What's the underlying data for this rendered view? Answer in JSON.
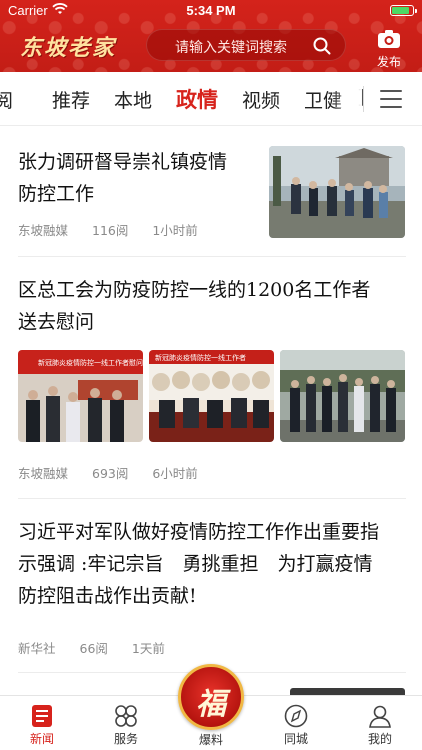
{
  "status_bar": {
    "carrier": "Carrier",
    "time": "5:34 PM",
    "battery_level": 0.8
  },
  "header": {
    "logo_text": "东坡老家",
    "search_placeholder": "请输入关键词搜索",
    "publish_label": "发布",
    "colors": {
      "brand_red": "#d4231b",
      "active_tab": "#d7231c"
    }
  },
  "tabs": {
    "items": [
      "阅",
      "推荐",
      "本地",
      "政情",
      "视频",
      "卫健",
      "]"
    ],
    "active": "政情",
    "menu_icon": "hamburger-icon"
  },
  "articles": [
    {
      "title_line1": "张力调研督导崇礼镇疫情",
      "title_line2": "防控工作",
      "source": "东坡融媒",
      "reads": "116阅",
      "time": "1小时前"
    },
    {
      "title_line1": "区总工会为防疫防控一线的1200名工作者",
      "title_line2": "送去慰问",
      "source": "东坡融媒",
      "reads": "693阅",
      "time": "6小时前",
      "banner_text_1": "新冠肺炎疫情防控一线工作者慰问活动",
      "banner_text_2": "新冠肺炎疫情防控一线工作者"
    },
    {
      "title_line1": "习近平对军队做好疫情防控工作作出重要指",
      "title_line2": "示强调 :牢记宗旨　勇挑重担　为打赢疫情",
      "title_line3": "防控阻击战作出贡献!",
      "source": "新华社",
      "reads": "66阅",
      "time": "1天前"
    }
  ],
  "bottom_nav": {
    "news": "新闻",
    "services": "服务",
    "report_char": "福",
    "report": "爆料",
    "city": "同城",
    "mine": "我的"
  }
}
